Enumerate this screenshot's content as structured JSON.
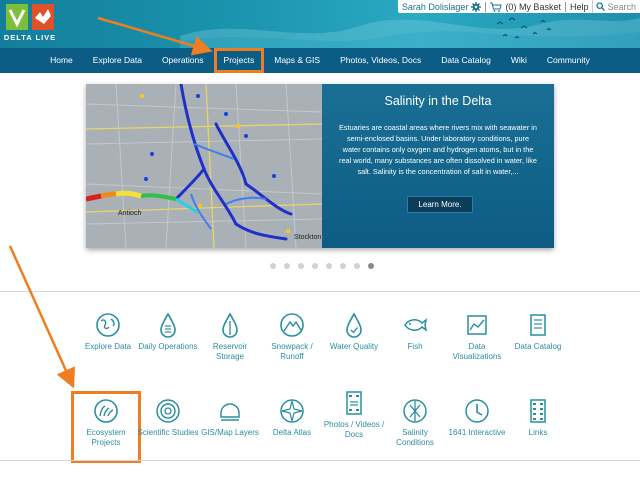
{
  "header": {
    "logo_text": "DELTA LIVE",
    "user_name": "Sarah Dolislager",
    "basket_label": "(0) My Basket",
    "help_label": "Help",
    "search_placeholder": "Search"
  },
  "nav": {
    "items": [
      {
        "label": "Home"
      },
      {
        "label": "Explore Data"
      },
      {
        "label": "Operations"
      },
      {
        "label": "Projects",
        "active": true
      },
      {
        "label": "Maps & GIS"
      },
      {
        "label": "Photos, Videos, Docs"
      },
      {
        "label": "Data Catalog"
      },
      {
        "label": "Wiki"
      },
      {
        "label": "Community"
      }
    ]
  },
  "carousel": {
    "title": "Salinity in the Delta",
    "body": "Estuaries are coastal areas where rivers mix with seawater in semi-enclosed basins. Under laboratory conditions, pure water contains only oxygen and hydrogen atoms, but in the real world, many substances are often dissolved in water, like salt. Salinity is the concentration of salt in water,...",
    "button_label": "Learn More.",
    "map_label_antioch": "Antioch",
    "map_label_stockton": "Stockton",
    "dots_count": 8,
    "active_dot": 8
  },
  "tiles": {
    "row1": [
      {
        "label": "Explore Data",
        "icon": "globe-icon"
      },
      {
        "label": "Daily Operations",
        "icon": "drop-gauge-icon"
      },
      {
        "label": "Reservoir Storage",
        "icon": "reservoir-drop-icon"
      },
      {
        "label": "Snowpack / Runoff",
        "icon": "mountain-icon"
      },
      {
        "label": "Water Quality",
        "icon": "water-drop-check-icon"
      },
      {
        "label": "Fish",
        "icon": "fish-icon"
      },
      {
        "label": "Data Visualizations",
        "icon": "chart-icon"
      },
      {
        "label": "Data Catalog",
        "icon": "catalog-icon"
      }
    ],
    "row2": [
      {
        "label": "Ecosystem Projects",
        "icon": "ecosystem-icon"
      },
      {
        "label": "Scientific Studies",
        "icon": "target-icon"
      },
      {
        "label": "GIS/Map Layers",
        "icon": "map-layers-icon"
      },
      {
        "label": "Delta Atlas",
        "icon": "compass-icon"
      },
      {
        "label": "Photos / Videos / Docs",
        "icon": "film-doc-icon"
      },
      {
        "label": "Salinity Conditions",
        "icon": "salinity-icon"
      },
      {
        "label": "1641 Interactive",
        "icon": "interactive-icon"
      },
      {
        "label": "Links",
        "icon": "film-links-icon"
      }
    ]
  },
  "colors": {
    "nav_bg": "#0c5d86",
    "accent_orange": "#ef7d22",
    "tile_teal": "#2a8ea1"
  }
}
